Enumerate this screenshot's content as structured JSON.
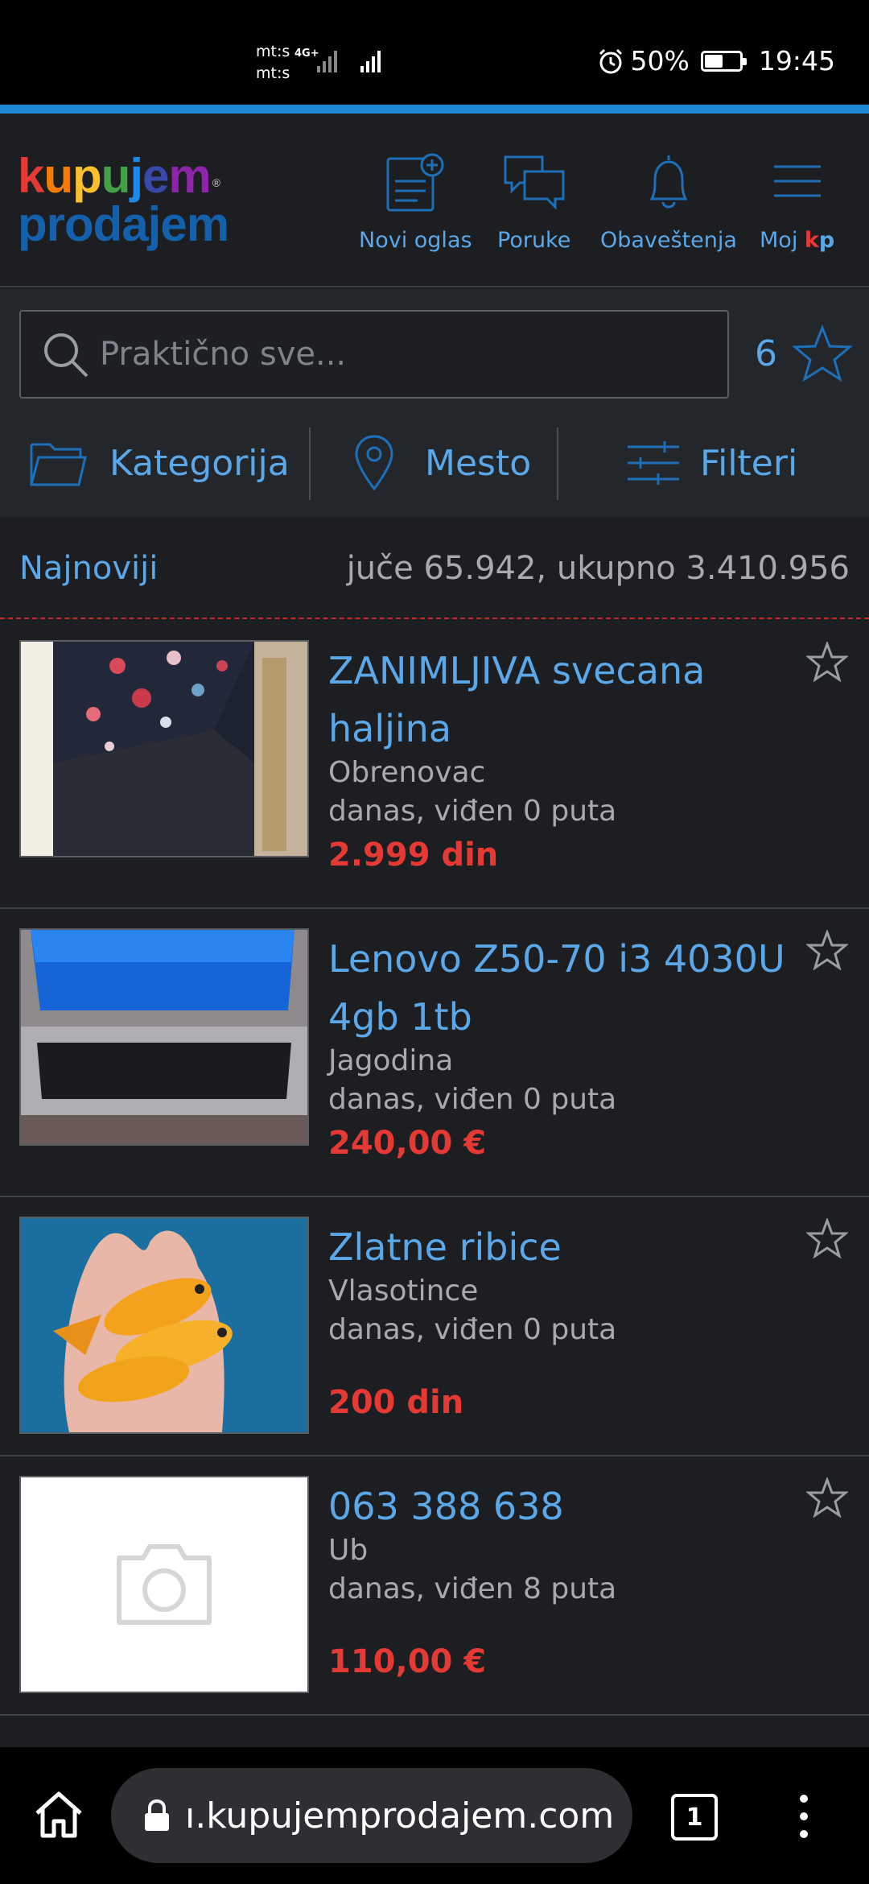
{
  "status_bar": {
    "carrier1": "mt:s",
    "carrier2": "mt:s",
    "network": "4G+",
    "battery": "50%",
    "time": "19:45"
  },
  "header": {
    "logo_line1": [
      "k",
      "u",
      "p",
      "u",
      "j",
      "e",
      "m"
    ],
    "logo_line1_colors": [
      "#e53935",
      "#f57c00",
      "#fbc02d",
      "#43a047",
      "#1e88e5",
      "#3949ab",
      "#8e24aa"
    ],
    "logo_line2": "prodajem",
    "logo_reg": "®",
    "nav": {
      "new_ad": "Novi oglas",
      "messages": "Poruke",
      "notifications": "Obaveštenja",
      "my": "Moj",
      "my_k": "k",
      "my_p": "p"
    }
  },
  "search": {
    "placeholder": "Praktično sve...",
    "saved_count": "6"
  },
  "filters": {
    "category": "Kategorija",
    "location": "Mesto",
    "filters": "Filteri"
  },
  "sort": {
    "label": "Najnoviji",
    "stats": "juče 65.942, ukupno 3.410.956"
  },
  "listings": [
    {
      "title": "ZANIMLJIVA svecana haljina",
      "location": "Obrenovac",
      "seen": "danas, viđen 0 puta",
      "price": "2.999 din"
    },
    {
      "title": "Lenovo Z50-70 i3 4030U 4gb 1tb",
      "location": "Jagodina",
      "seen": "danas, viđen 0 puta",
      "price": "240,00 €"
    },
    {
      "title": "Zlatne ribice",
      "location": "Vlasotince",
      "seen": "danas, viđen 0 puta",
      "price": "200 din"
    },
    {
      "title": "063 388 638",
      "location": "Ub",
      "seen": "danas, viđen 8 puta",
      "price": "110,00 €"
    }
  ],
  "browser": {
    "url": "ı.kupujemprodajem.com",
    "tab_count": "1"
  },
  "colors": {
    "accent": "#5ca7e8",
    "price": "#e53935",
    "top_line": "#1e88d6"
  }
}
